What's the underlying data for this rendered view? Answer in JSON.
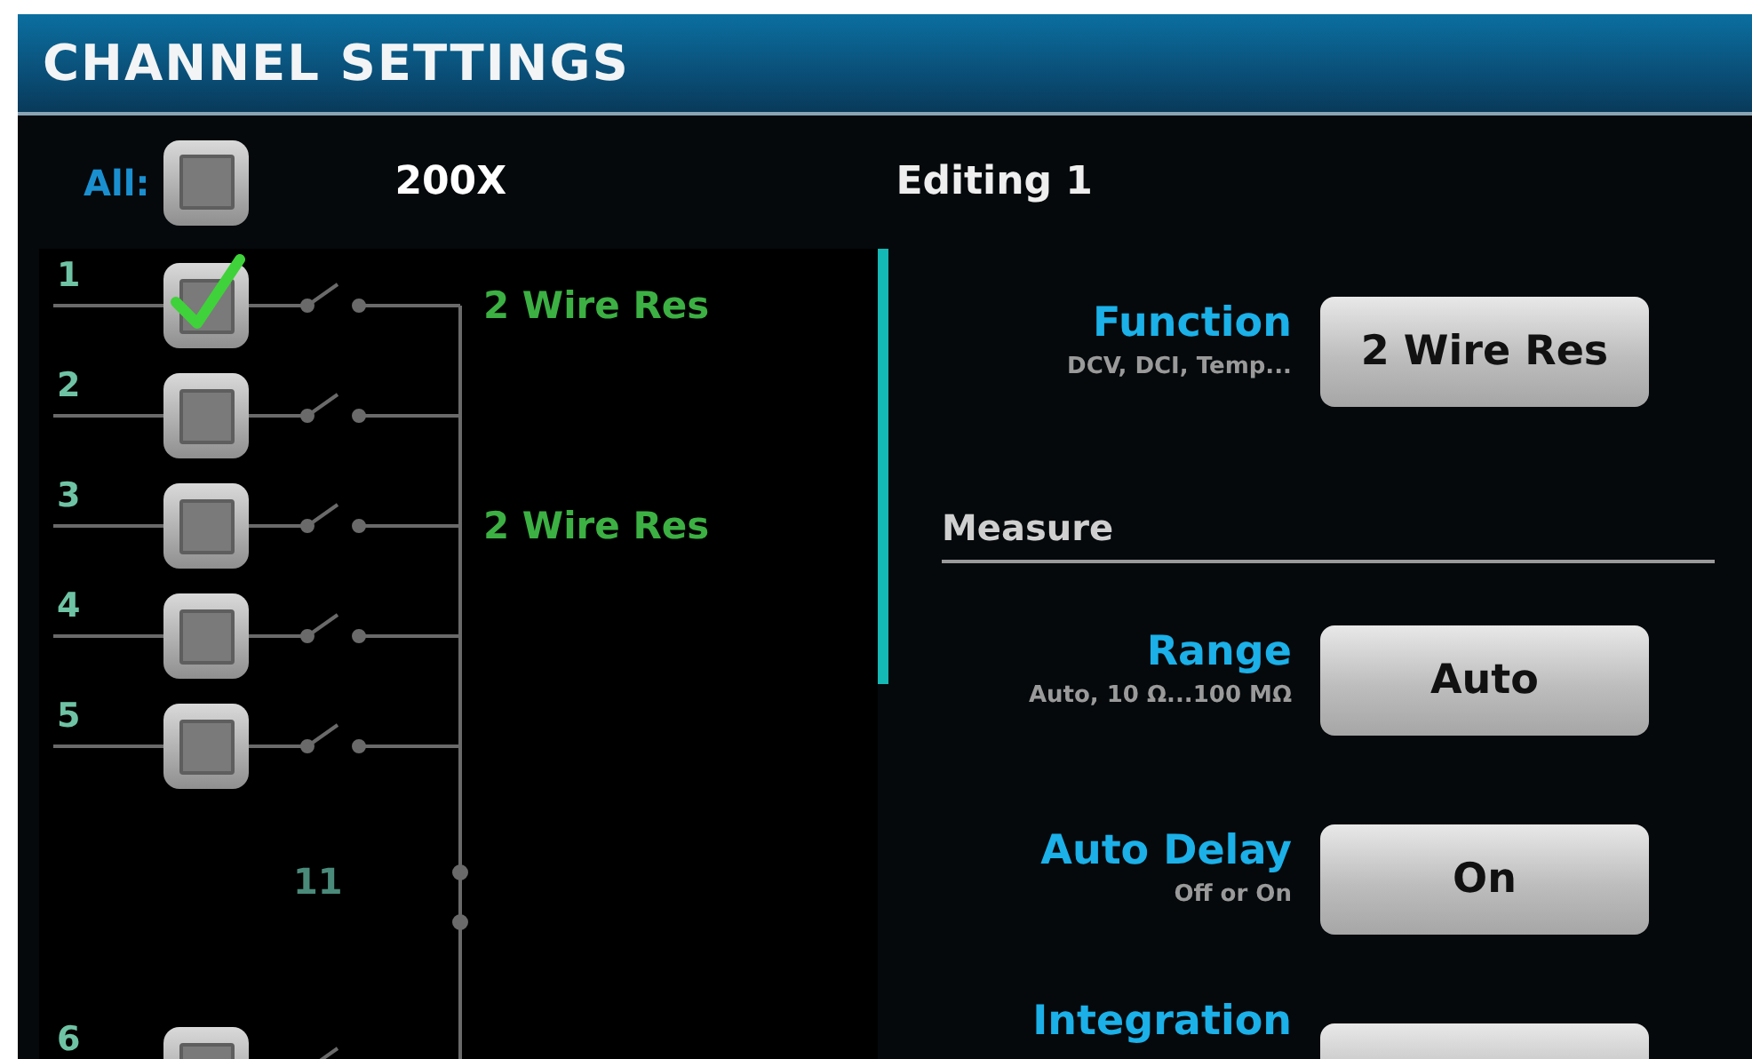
{
  "header": {
    "title": "CHANNEL SETTINGS"
  },
  "toolbar": {
    "all_label": "All:",
    "all_checked": false,
    "card": "200X",
    "editing": "Editing 1"
  },
  "channels": [
    {
      "number": "1",
      "checked": true,
      "function": "2 Wire Res"
    },
    {
      "number": "2",
      "checked": false
    },
    {
      "number": "3",
      "checked": false,
      "function": "2 Wire Res"
    },
    {
      "number": "4",
      "checked": false
    },
    {
      "number": "5",
      "checked": false
    },
    {
      "number": "6",
      "checked": false
    }
  ],
  "bus_label": "11",
  "settings": [
    {
      "kind": "setting",
      "label": "Function",
      "hint": "DCV, DCI, Temp...",
      "value": "2 Wire Res"
    },
    {
      "kind": "section",
      "label": "Measure"
    },
    {
      "kind": "setting",
      "label": "Range",
      "hint": "Auto, 10 Ω...100 MΩ",
      "value": "Auto"
    },
    {
      "kind": "setting",
      "label": "Auto Delay",
      "hint": "Off or On",
      "value": "On"
    },
    {
      "kind": "setting",
      "label": "Integration"
    }
  ]
}
